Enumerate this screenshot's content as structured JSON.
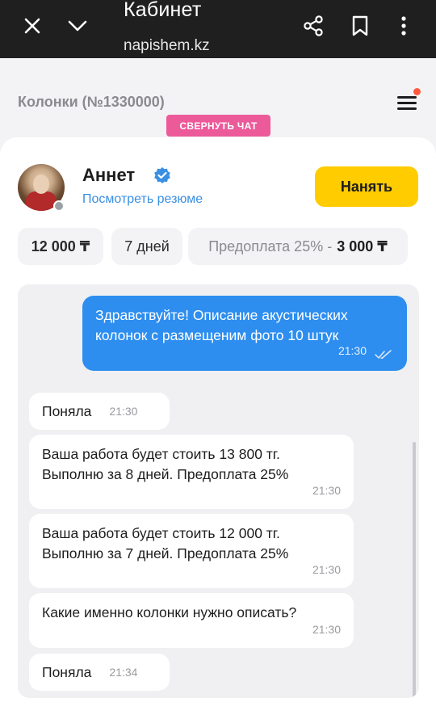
{
  "browser": {
    "title": "Кабинет",
    "url": "napishem.kz",
    "icons": [
      "close-icon",
      "chevron-down-icon",
      "share-icon",
      "bookmark-icon",
      "more-vertical-icon"
    ]
  },
  "page": {
    "title": "Колонки (№1330000)",
    "collapse_chat_label": "СВЕРНУТЬ ЧАТ",
    "menu_icon": "hamburger-menu-icon"
  },
  "chat": {
    "freelancer_name": "Аннет",
    "resume_link": "Посмотреть резюме",
    "hire_label": "Нанять",
    "price": "12 000 ₸",
    "days": "7 дней",
    "prepay_label": "Предоплата 25% -",
    "prepay_amount": "3 000 ₸",
    "colors": {
      "accent_yellow": "#ffcc00",
      "outgoing_blue": "#2d8ef0",
      "link_blue": "#3a8fe3",
      "collapse_pink": "#ec5a9a"
    }
  },
  "messages": [
    {
      "direction": "out",
      "text": "Здравствуйте! Описание акустических\nколонок с размещеним фото 10 штук",
      "time": "21:30",
      "read": true
    },
    {
      "direction": "in",
      "text": "Поняла",
      "time": "21:30"
    },
    {
      "direction": "in",
      "text": "Ваша работа будет стоить 13 800 тг.\nВыполню за 8 дней. Предоплата 25%",
      "time": "21:30"
    },
    {
      "direction": "in",
      "text": "Ваша работа будет стоить 12 000 тг.\nВыполню за 7 дней. Предоплата 25%",
      "time": "21:30"
    },
    {
      "direction": "in",
      "text": "Какие именно колонки нужно описать?",
      "time": "21:30"
    },
    {
      "direction": "in",
      "text": "Поняла",
      "time": "21:34"
    }
  ]
}
